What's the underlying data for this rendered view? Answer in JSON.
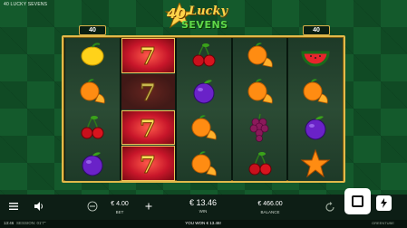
{
  "game": {
    "title": "40 LUCKY SEVENS",
    "logo": {
      "number": "40",
      "word1": "Lucky",
      "word2": "SEVENS"
    }
  },
  "paylines": {
    "left": "40",
    "right": "40"
  },
  "reels": [
    [
      "lemon",
      "orange",
      "cherries",
      "plum"
    ],
    [
      "seven-lit",
      "seven-dim",
      "seven-lit",
      "seven-lit"
    ],
    [
      "cherries",
      "plum",
      "orange",
      "orange"
    ],
    [
      "orange",
      "orange",
      "grapes",
      "cherries"
    ],
    [
      "watermelon",
      "orange",
      "plum",
      "star"
    ]
  ],
  "controls": {
    "bet_value": "€ 4.00",
    "bet_label": "BET",
    "win_value": "€ 13.46",
    "win_label": "WIN",
    "balance_value": "€ 466.00",
    "balance_label": "BALANCE"
  },
  "status": {
    "clock": "13:46",
    "session": "SESSION: 01'7\"",
    "won_message": "YOU WON € 13.46!",
    "brand": "GREENTUBE"
  },
  "colors": {
    "frame_gold": "#e2b94a",
    "background_green": "#145a2c",
    "seven_red": "#c8162a"
  }
}
